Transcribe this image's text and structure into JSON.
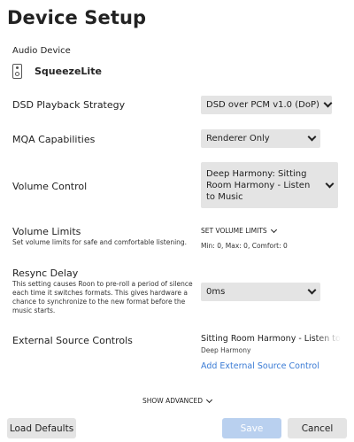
{
  "header": {
    "title": "Device Setup"
  },
  "audio_device": {
    "label": "Audio Device",
    "name": "SqueezeLite",
    "icon": "speaker-icon"
  },
  "dsd": {
    "label": "DSD Playback Strategy",
    "value": "DSD over PCM v1.0 (DoP)"
  },
  "mqa": {
    "label": "MQA Capabilities",
    "value": "Renderer Only"
  },
  "volume_control": {
    "label": "Volume Control",
    "value": "Deep Harmony: Sitting Room Harmony - Listen to Music"
  },
  "volume_limits": {
    "label": "Volume Limits",
    "description": "Set volume limits for safe and comfortable listening.",
    "link": "SET VOLUME LIMITS",
    "values": "Min: 0, Max: 0, Comfort: 0"
  },
  "resync": {
    "label": "Resync Delay",
    "description": "This setting causes Roon to pre-roll a period of silence each time it switches formats. This gives hardware a chance to synchronize to the new format before the music starts.",
    "value": "0ms"
  },
  "external_source": {
    "label": "External Source Controls",
    "primary": "Sitting Room Harmony - Listen to Music",
    "secondary": "Deep Harmony",
    "add_link": "Add External Source Control"
  },
  "show_advanced": "SHOW ADVANCED",
  "footer": {
    "load_defaults": "Load Defaults",
    "save": "Save",
    "cancel": "Cancel"
  },
  "colors": {
    "accent_link": "#3a7bd5",
    "save_disabled": "#b9d0ef",
    "control_bg": "#e4e4e4"
  }
}
